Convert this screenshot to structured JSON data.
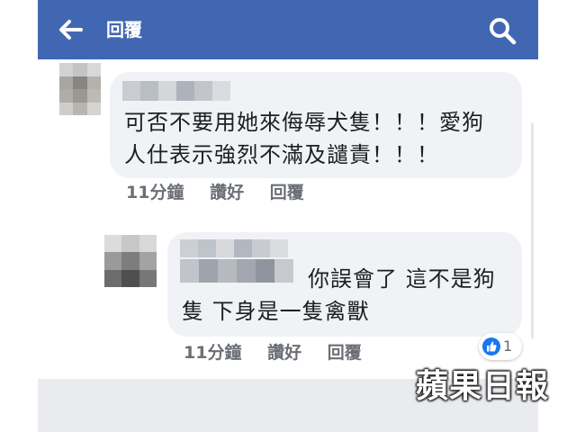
{
  "header": {
    "title": "回覆",
    "back_icon": "arrow-left-icon",
    "search_icon": "search-icon",
    "background": "#4267b2"
  },
  "comments": [
    {
      "text": "可否不要用她來侮辱犬隻！！！愛狗人仕表示強烈不滿及譴責！！！",
      "lines": [
        "可否不要用她來侮辱犬隻！！！愛狗",
        "人仕表示強烈不滿及譴責！！！"
      ],
      "timestamp": "11分鐘",
      "like_label": "讚好",
      "reply_label": "回覆"
    },
    {
      "text": "你誤會了 這不是狗隻 下身是一隻禽獸",
      "lines": [
        "你誤會了 這不是狗",
        "隻 下身是一隻禽獸"
      ],
      "timestamp": "11分鐘",
      "like_label": "讚好",
      "reply_label": "回覆",
      "reaction": {
        "icon": "thumbs-up-icon",
        "count": "1"
      }
    }
  ],
  "watermark": "蘋果日報"
}
